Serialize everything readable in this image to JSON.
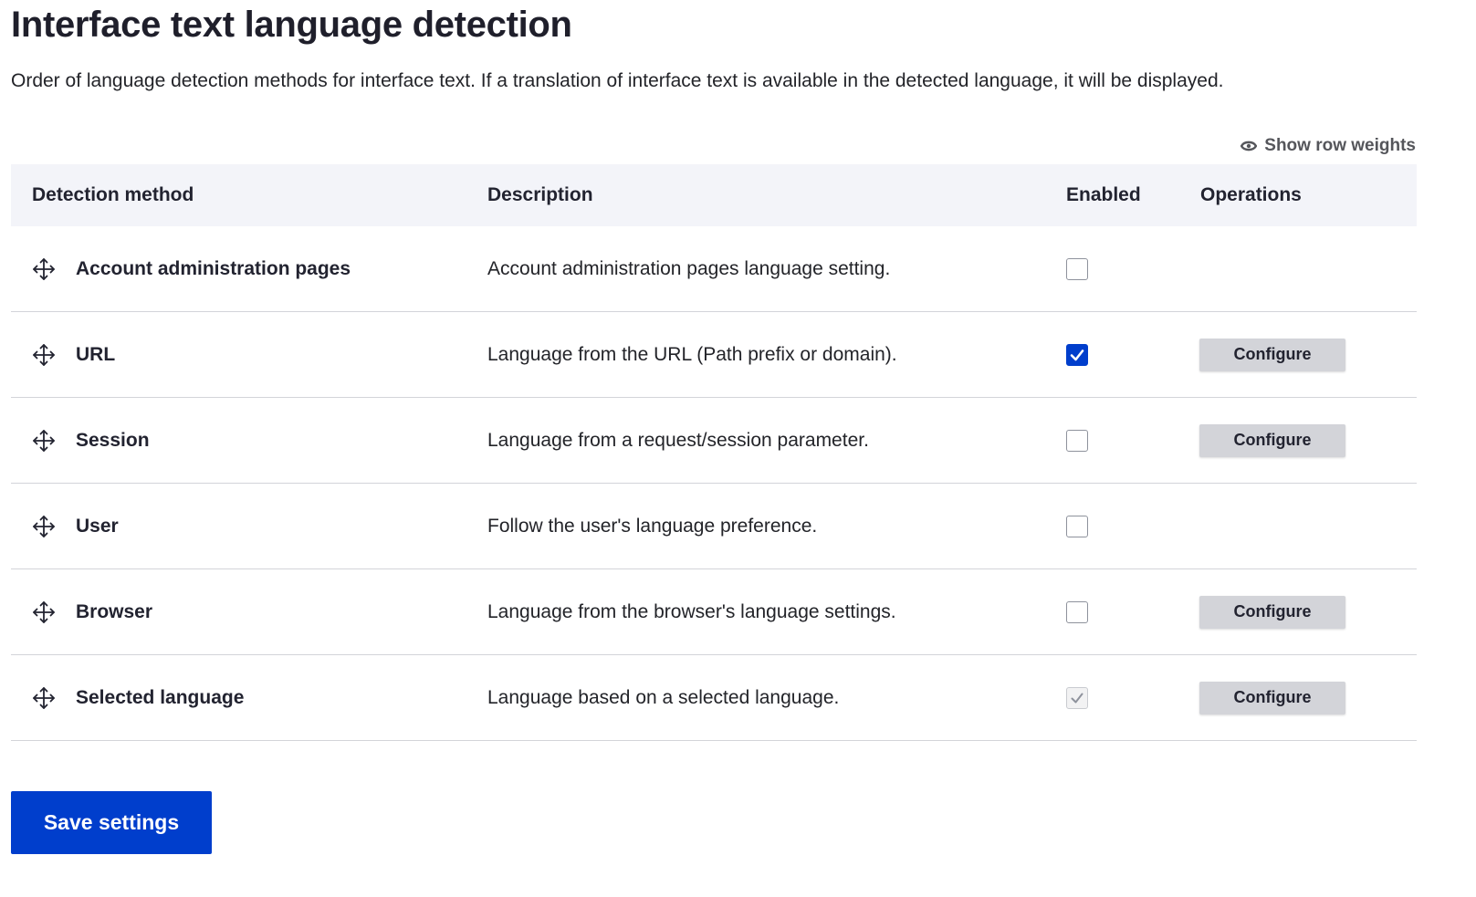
{
  "page": {
    "title": "Interface text language detection",
    "description": "Order of language detection methods for interface text. If a translation of interface text is available in the detected language, it will be displayed."
  },
  "show_row_weights": {
    "label": "Show row weights",
    "icon": "eye-icon"
  },
  "table": {
    "headers": {
      "method": "Detection method",
      "description": "Description",
      "enabled": "Enabled",
      "operations": "Operations"
    },
    "rows": [
      {
        "name": "Account administration pages",
        "description": "Account administration pages language setting.",
        "enabled": false,
        "disabled": false,
        "configure": null
      },
      {
        "name": "URL",
        "description": "Language from the URL (Path prefix or domain).",
        "enabled": true,
        "disabled": false,
        "configure": "Configure"
      },
      {
        "name": "Session",
        "description": "Language from a request/session parameter.",
        "enabled": false,
        "disabled": false,
        "configure": "Configure"
      },
      {
        "name": "User",
        "description": "Follow the user's language preference.",
        "enabled": false,
        "disabled": false,
        "configure": null
      },
      {
        "name": "Browser",
        "description": "Language from the browser's language settings.",
        "enabled": false,
        "disabled": false,
        "configure": "Configure"
      },
      {
        "name": "Selected language",
        "description": "Language based on a selected language.",
        "enabled": true,
        "disabled": true,
        "configure": "Configure"
      }
    ]
  },
  "actions": {
    "save_label": "Save settings"
  },
  "colors": {
    "primary": "#003ecc",
    "header_bg": "#f3f4f9",
    "button_gray": "#d3d4d9",
    "border": "#d3d4d9"
  }
}
